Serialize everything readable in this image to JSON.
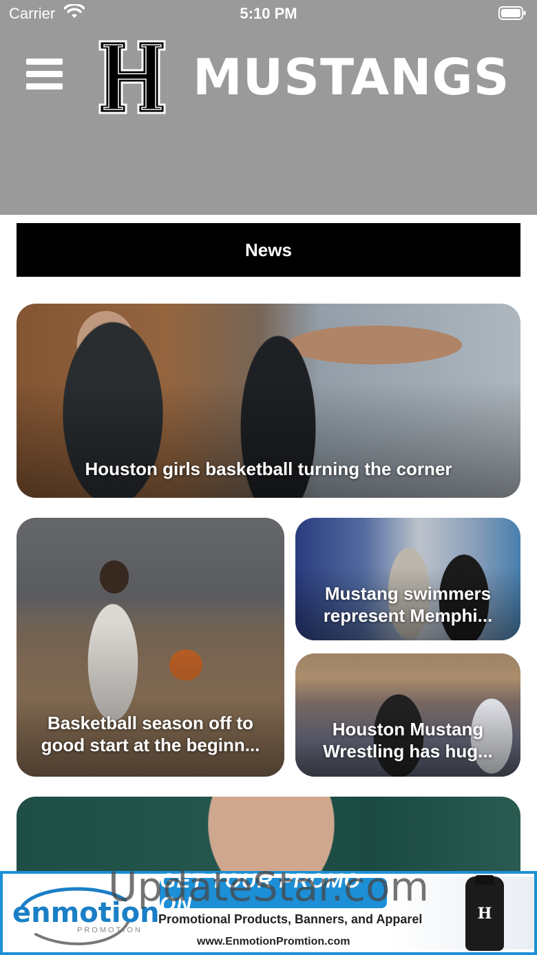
{
  "status_bar": {
    "carrier": "Carrier",
    "time": "5:10 PM",
    "icons": [
      "wifi-icon",
      "battery-icon"
    ]
  },
  "header": {
    "menu_icon": "hamburger-menu-icon",
    "logo_letter": "H",
    "brand": "MUSTANGS",
    "colors": {
      "background": "#9a9a9a",
      "text": "#ffffff"
    }
  },
  "section": {
    "title": "News"
  },
  "articles": [
    {
      "title": "Houston girls basketball turning the corner"
    },
    {
      "title": "Basketball season off to good start at the beginn..."
    },
    {
      "title": "Mustang swimmers represent Memphi..."
    },
    {
      "title": "Houston Mustang Wrestling has hug..."
    },
    {
      "title": ""
    }
  ],
  "ad": {
    "brand": "enmotion",
    "brand_sub": "PROMOTION",
    "headline": "GET YOUR PROMO ON",
    "tagline": "Promotional Products, Banners, and Apparel",
    "url": "www.EnmotionPromtion.com",
    "product_letter": "H",
    "colors": {
      "accent": "#1d8fd6"
    }
  },
  "watermark": "UpdateStar.com"
}
